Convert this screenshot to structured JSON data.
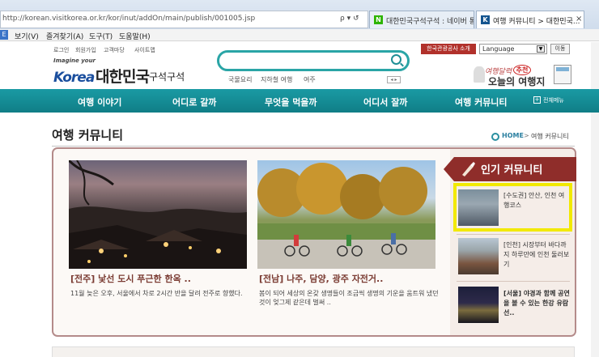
{
  "browser": {
    "url": "http://korean.visitkorea.or.kr/kor/inut/addOn/main/publish/001005.jsp",
    "addr_icons": "ρ ▾ ↺",
    "tabs": [
      {
        "label": "대한민국구석구석 : 네이버 통..."
      },
      {
        "label": "여행 커뮤니티 > 대한민국..."
      }
    ],
    "tab_close": "×",
    "tab_icons": [
      "N",
      "K"
    ],
    "menu_mark": "E",
    "menu": [
      "보기(V)",
      "즐겨찾기(A)",
      "도구(T)",
      "도움말(H)"
    ]
  },
  "header": {
    "utility_links": [
      "로그인",
      "회원가입",
      "고객마당",
      "사이트맵"
    ],
    "logo_imagine": "Imagine your",
    "logo_korea": "Korea",
    "logo_title": "대한민국",
    "logo_sub": "구석구석",
    "search_placeholder": "",
    "keywords": [
      "국물요리",
      "지하철 여행",
      "여주"
    ],
    "kw_nav": "◂ ▸",
    "notice_button": "한국관광공사 소개",
    "language_select": "Language",
    "language_arrow": "▼",
    "go_button": "이동",
    "promo_line1": "여행달력",
    "promo_badge": "추천",
    "promo_line2": "오늘의 여행지"
  },
  "nav": {
    "items": [
      "여행 이야기",
      "어디로 갈까",
      "무엇을 먹을까",
      "어디서 잘까",
      "여행 커뮤니티"
    ],
    "all_menu": "전체메뉴",
    "all_menu_icon": "+"
  },
  "page": {
    "title": "여행 커뮤니티",
    "breadcrumb_home": "HOME",
    "breadcrumb_sep": ">",
    "breadcrumb_current": "여행 커뮤니티"
  },
  "cards": [
    {
      "title": "[전주] 낯선 도시 푸근한 한옥 ..",
      "desc": "11월 늦은 오후, 서울에서 차로 2시간 반을 달려 전주로 향했다."
    },
    {
      "title": "[전남] 나주, 담양, 광주 자전거..",
      "desc": "봄이 되어 세상의 온갖 생명들이 조금씩 생명의 기운을 움트워 냈던 것이 엊그제 같은데 벌써 .."
    }
  ],
  "popular": {
    "title": "인기 커뮤니티",
    "items": [
      {
        "text": "[수도권] 안산, 인천 여행코스"
      },
      {
        "text": "[인천] 시장부터 바다까지 하루만에 인천 둘러보기"
      },
      {
        "text": "[서울] 야경과 함께 공연을 볼 수 있는 한강 유람선.."
      }
    ]
  },
  "colors": {
    "nav_teal": "#138c95",
    "accent_red": "#8f2d2a",
    "highlight_yellow": "#f2e900"
  }
}
